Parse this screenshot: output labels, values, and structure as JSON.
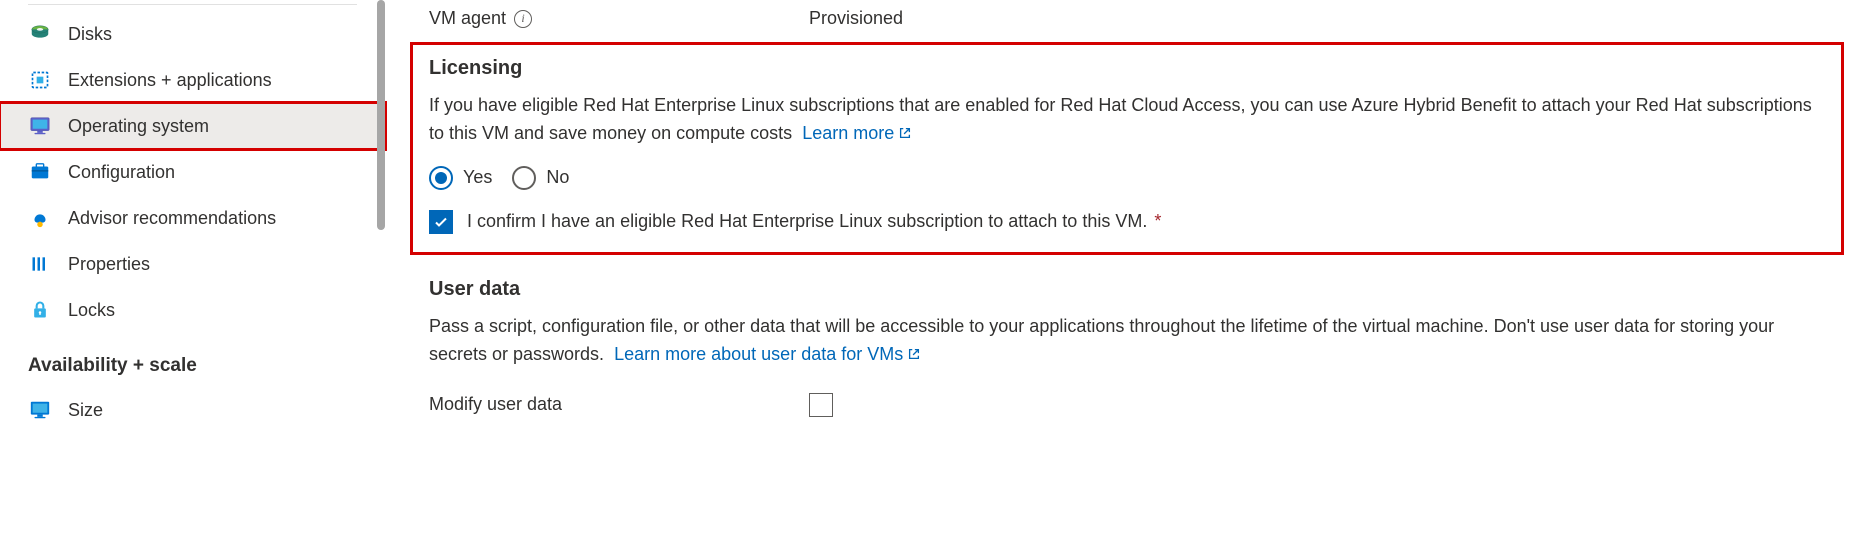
{
  "sidebar": {
    "items": [
      {
        "label": "Disks"
      },
      {
        "label": "Extensions + applications"
      },
      {
        "label": "Operating system"
      },
      {
        "label": "Configuration"
      },
      {
        "label": "Advisor recommendations"
      },
      {
        "label": "Properties"
      },
      {
        "label": "Locks"
      }
    ],
    "section_heading": "Availability + scale",
    "items2": [
      {
        "label": "Size"
      }
    ]
  },
  "vm_agent": {
    "label": "VM agent",
    "value": "Provisioned"
  },
  "licensing": {
    "title": "Licensing",
    "description": "If you have eligible Red Hat Enterprise Linux subscriptions that are enabled for Red Hat Cloud Access, you can use Azure Hybrid Benefit to attach your Red Hat subscriptions to this VM and save money on compute costs",
    "learn_more": "Learn more",
    "yes_label": "Yes",
    "no_label": "No",
    "selected": "yes",
    "confirm_label": "I confirm I have an eligible Red Hat Enterprise Linux subscription to attach to this VM.",
    "required_mark": "*"
  },
  "user_data": {
    "title": "User data",
    "description": "Pass a script, configuration file, or other data that will be accessible to your applications throughout the lifetime of the virtual machine. Don't use user data for storing your secrets or passwords.",
    "learn_more": "Learn more about user data for VMs",
    "modify_label": "Modify user data"
  }
}
